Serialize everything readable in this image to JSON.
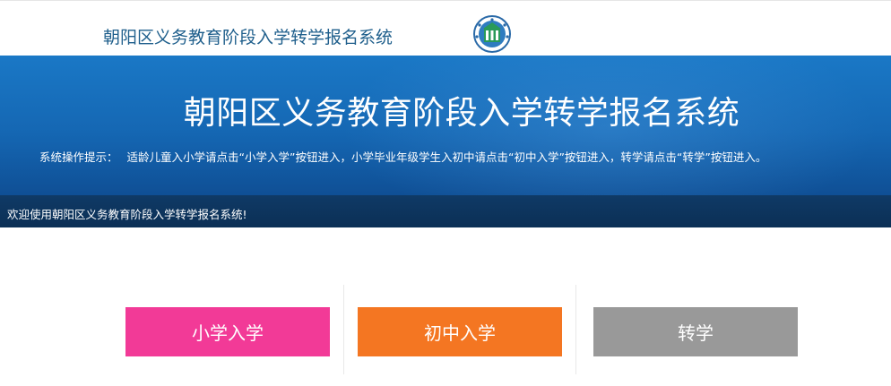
{
  "header": {
    "title": "朝阳区义务教育阶段入学转学报名系统",
    "logo_icon": "school-emblem-icon"
  },
  "banner": {
    "title": "朝阳区义务教育阶段入学转学报名系统",
    "tip_label": "系统操作提示：",
    "tip_text": "适龄儿童入小学请点击“小学入学”按钮进入，小学毕业年级学生入初中请点击“初中入学”按钮进入，转学请点击“转学”按钮进入。"
  },
  "welcome": {
    "text": "欢迎使用朝阳区义务教育阶段入学转学报名系统!"
  },
  "buttons": {
    "primary": "小学入学",
    "middle": "初中入学",
    "transfer": "转学"
  },
  "colors": {
    "primary_button": "#f23a97",
    "middle_button": "#f47622",
    "transfer_button": "#999999",
    "banner_blue": "#1567b3",
    "welcome_bar": "#0b2f55"
  }
}
